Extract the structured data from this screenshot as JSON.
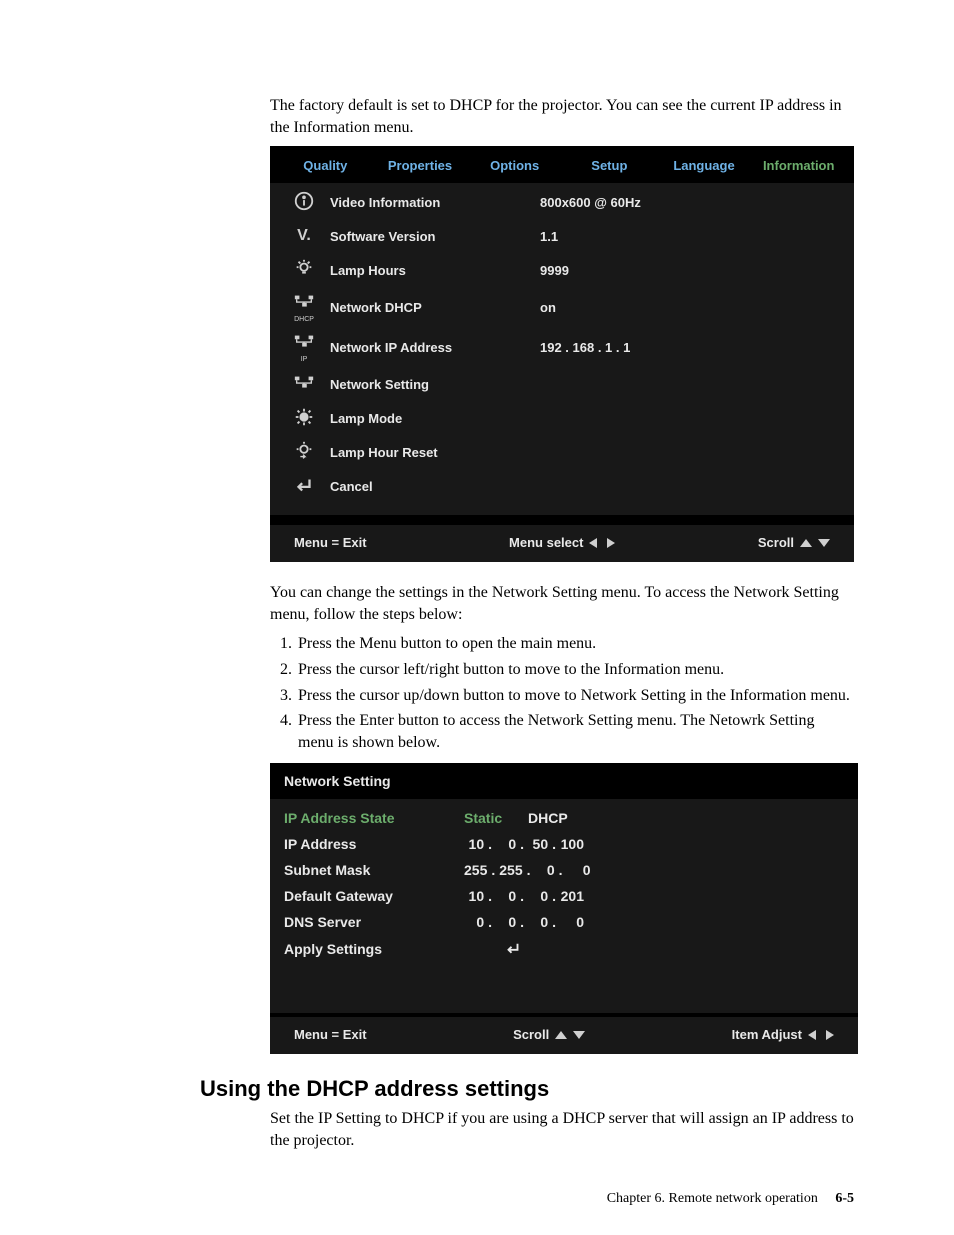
{
  "para1": "The factory default is set to DHCP for the projector. You can see the current IP address in the Information menu.",
  "osd": {
    "tabs": [
      "Quality",
      "Properties",
      "Options",
      "Setup",
      "Language",
      "Information"
    ],
    "active_tab_index": 5,
    "rows": [
      {
        "icon": "info",
        "label": "Video Information",
        "value": "800x600 @ 60Hz"
      },
      {
        "icon": "version",
        "label": "Software Version",
        "value": "1.1"
      },
      {
        "icon": "lamp",
        "label": "Lamp Hours",
        "value": "9999"
      },
      {
        "icon": "net-dhcp",
        "label": "Network DHCP",
        "value": "on"
      },
      {
        "icon": "net-ip",
        "label": "Network IP Address",
        "value": "192 . 168 . 1 . 1"
      },
      {
        "icon": "net",
        "label": "Network Setting",
        "value": ""
      },
      {
        "icon": "lamp-mode",
        "label": "Lamp Mode",
        "value": ""
      },
      {
        "icon": "lamp-reset",
        "label": "Lamp Hour Reset",
        "value": ""
      },
      {
        "icon": "return",
        "label": "Cancel",
        "value": ""
      }
    ],
    "footer": {
      "exit": "Menu = Exit",
      "select": "Menu select",
      "scroll": "Scroll"
    }
  },
  "para2": "You can change the settings in the Network Setting menu. To access the Network Setting menu, follow the steps below:",
  "steps": [
    "Press the Menu button to open the main menu.",
    "Press the cursor left/right button to move to the Information menu.",
    "Press the cursor up/down button to move to Network Setting in the Information menu.",
    "Press the Enter button to access the Network Setting menu. The Netowrk Setting menu is shown below."
  ],
  "ns": {
    "title": "Network Setting",
    "rows": {
      "ip_state": {
        "label": "IP Address State",
        "static": "Static",
        "dhcp": "DHCP",
        "active": true
      },
      "ip": {
        "label": "IP Address",
        "value": [
          "10",
          "0",
          "50",
          "100"
        ]
      },
      "mask": {
        "label": "Subnet Mask",
        "value": [
          "255",
          "255",
          "0",
          "0"
        ]
      },
      "gw": {
        "label": "Default Gateway",
        "value": [
          "10",
          "0",
          "0",
          "201"
        ]
      },
      "dns": {
        "label": "DNS Server",
        "value": [
          "0",
          "0",
          "0",
          "0"
        ]
      },
      "apply": {
        "label": "Apply Settings"
      }
    },
    "footer": {
      "exit": "Menu = Exit",
      "scroll": "Scroll",
      "adjust": "Item Adjust"
    }
  },
  "heading2": "Using the DHCP address settings",
  "para3": "Set the IP Setting to DHCP if you are using a DHCP server that will assign an IP address to the projector.",
  "footer": {
    "chapter": "Chapter 6. Remote network operation",
    "page": "6-5"
  }
}
